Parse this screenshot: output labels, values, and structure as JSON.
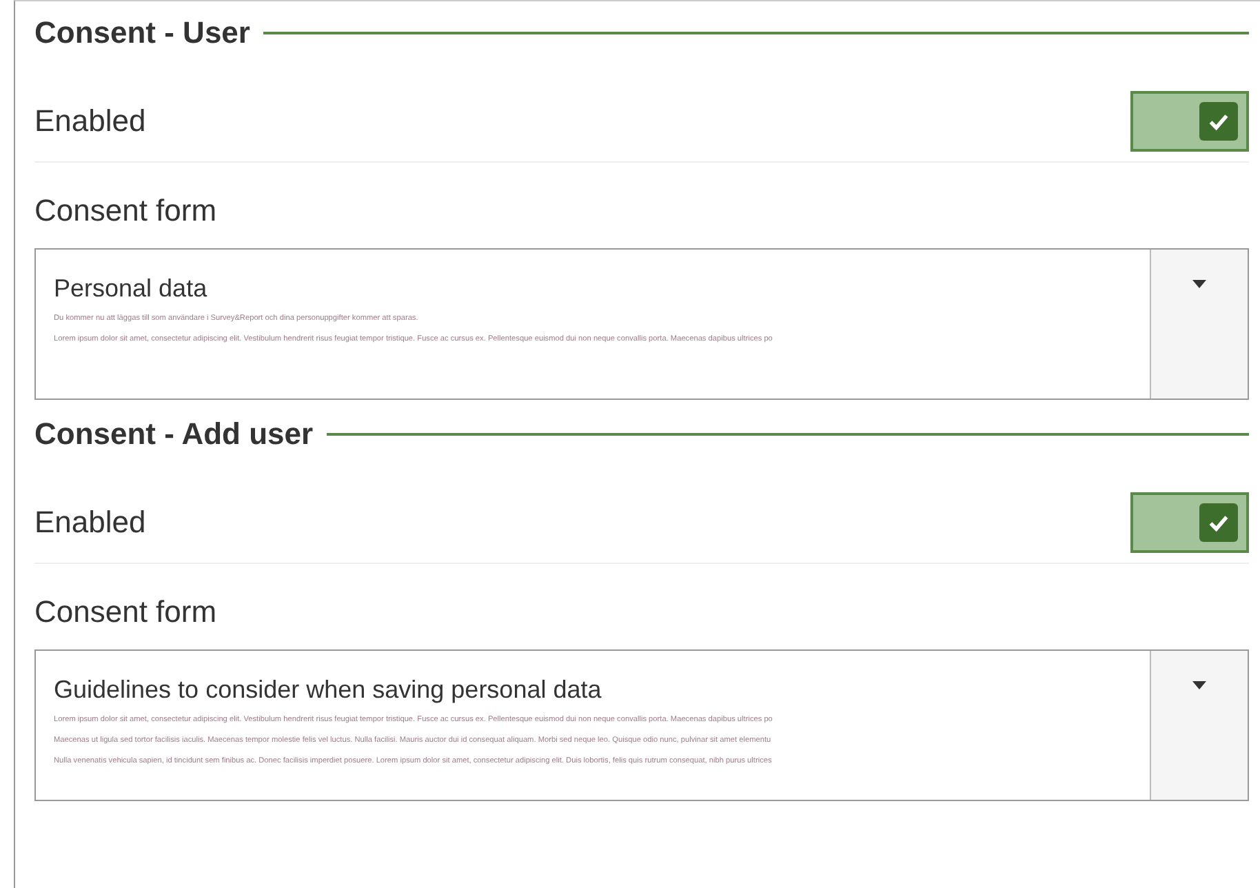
{
  "sections": [
    {
      "heading": "Consent - User",
      "enabled": {
        "label": "Enabled",
        "checked": true
      },
      "consent_form": {
        "label": "Consent form",
        "title": "Personal data",
        "lines": [
          "Du kommer nu att läggas till som användare i Survey&Report och dina personuppgifter kommer att sparas.",
          "Lorem ipsum dolor sit amet, consectetur adipiscing elit. Vestibulum hendrerit risus feugiat tempor tristique. Fusce ac cursus ex. Pellentesque euismod dui non neque convallis porta. Maecenas dapibus ultrices po"
        ]
      }
    },
    {
      "heading": "Consent - Add user",
      "enabled": {
        "label": "Enabled",
        "checked": true
      },
      "consent_form": {
        "label": "Consent form",
        "title": "Guidelines to consider when saving personal data",
        "lines": [
          "Lorem ipsum dolor sit amet, consectetur adipiscing elit. Vestibulum hendrerit risus feugiat tempor tristique. Fusce ac cursus ex. Pellentesque euismod dui non neque convallis porta. Maecenas dapibus ultrices po",
          "Maecenas ut ligula sed tortor facilisis iaculis. Maecenas tempor molestie felis vel luctus. Nulla facilisi. Mauris auctor dui id consequat aliquam. Morbi sed neque leo. Quisque odio nunc, pulvinar sit amet elementu",
          "Nulla venenatis vehicula sapien, id tincidunt sem finibus ac. Donec facilisis imperdiet posuere. Lorem ipsum dolor sit amet, consectetur adipiscing elit. Duis lobortis, felis quis rutrum consequat, nibh purus ultrices"
        ]
      }
    }
  ]
}
